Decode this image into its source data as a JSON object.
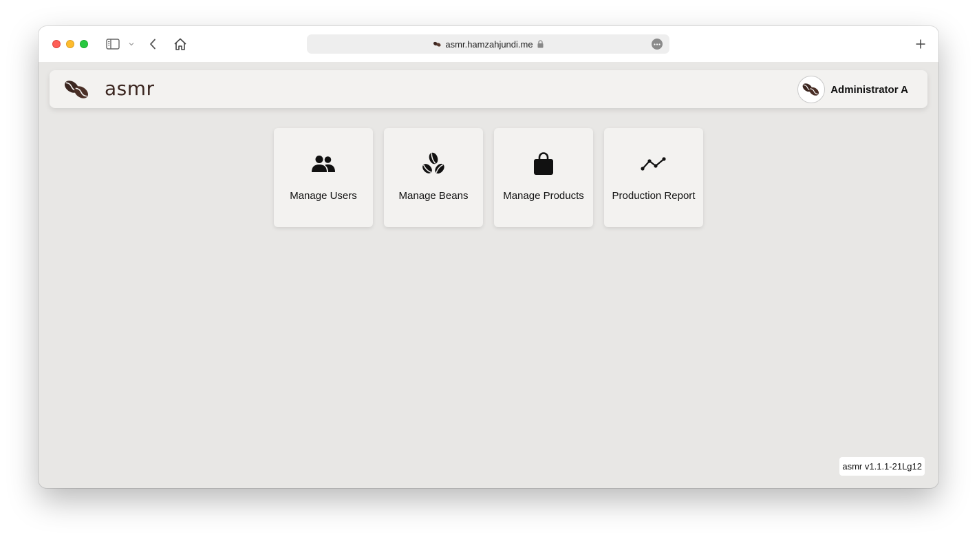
{
  "browser": {
    "url": "asmr.hamzahjundi.me"
  },
  "app": {
    "brand": "asmr",
    "user_name": "Administrator A",
    "version": "asmr v1.1.1-21Lg12",
    "accent_color": "#3b2620"
  },
  "cards": [
    {
      "label": "Manage Users",
      "icon": "users-icon"
    },
    {
      "label": "Manage Beans",
      "icon": "beans-icon"
    },
    {
      "label": "Manage Products",
      "icon": "shopping-bag-icon"
    },
    {
      "label": "Production Report",
      "icon": "line-chart-icon"
    }
  ]
}
